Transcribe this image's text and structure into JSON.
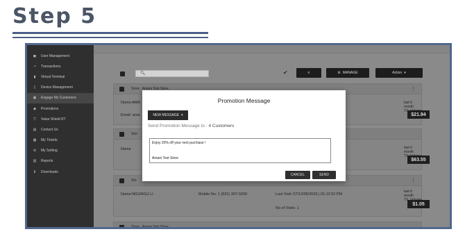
{
  "slide": {
    "title": "Step 5"
  },
  "sidebar": {
    "items": [
      {
        "label": "User Management",
        "icon": "users-icon"
      },
      {
        "label": "Transactions",
        "icon": "transactions-icon"
      },
      {
        "label": "Virtual Terminal",
        "icon": "terminal-icon"
      },
      {
        "label": "Device Management",
        "icon": "device-icon"
      },
      {
        "label": "Engage My Customers",
        "icon": "engage-icon",
        "active": true
      },
      {
        "label": "Promotions",
        "icon": "tag-icon"
      },
      {
        "label": "Value Shield RT",
        "icon": "shield-icon"
      },
      {
        "label": "Contact Us",
        "icon": "contact-icon"
      },
      {
        "label": "My Tickets",
        "icon": "ticket-icon"
      },
      {
        "label": "My Setting",
        "icon": "gear-icon"
      },
      {
        "label": "Reports",
        "icon": "reports-icon"
      },
      {
        "label": "Downloads",
        "icon": "download-icon"
      }
    ]
  },
  "toolbar": {
    "filter_icon": "≡",
    "manage_label": "MANAGE",
    "action_label": "Action"
  },
  "cards": [
    {
      "store": "Store : Amani Test Store",
      "name": "Name:AMA",
      "email": "Email: ama",
      "spent_label_1": "last 6 month",
      "spent_label_2": "TX_Volume",
      "spent_value": "$21.94"
    },
    {
      "store": "Stor",
      "name": "Name",
      "spent_label_1": "last 6 month",
      "spent_label_2": "TX_Volume",
      "spent_value": "$63.55"
    },
    {
      "store": "Sto",
      "name": "Name:NGUNGU LI",
      "mobile": "Mobile No: 1 (631) 307-0200",
      "last_visit": "Last Visit: 07/12/05/2020 | 01:12:52 PM",
      "visits": "No of Visits: 1",
      "spent_label_1": "last 6 month",
      "spent_label_2": "TX_Volume",
      "spent_value": "$1.05"
    },
    {
      "store": "Store : Amani Test Store"
    }
  ],
  "modal": {
    "title": "Promotion Message",
    "message_type_label": "NEW MESSAGE",
    "send_to_prefix": "Send Promotion Message to :",
    "send_to_count": "4 Customers",
    "message_line1": "Enjoy 20% off your next purchase !",
    "message_line2": "Amani Test Store",
    "cancel_label": "CANCEL",
    "send_label": "SEND"
  },
  "colors": {
    "accent": "#4a5f86",
    "sidebar_bg": "#2f2f2f",
    "overlay_bg": "#8a8a8a",
    "button_dark": "#2b2b2b"
  }
}
